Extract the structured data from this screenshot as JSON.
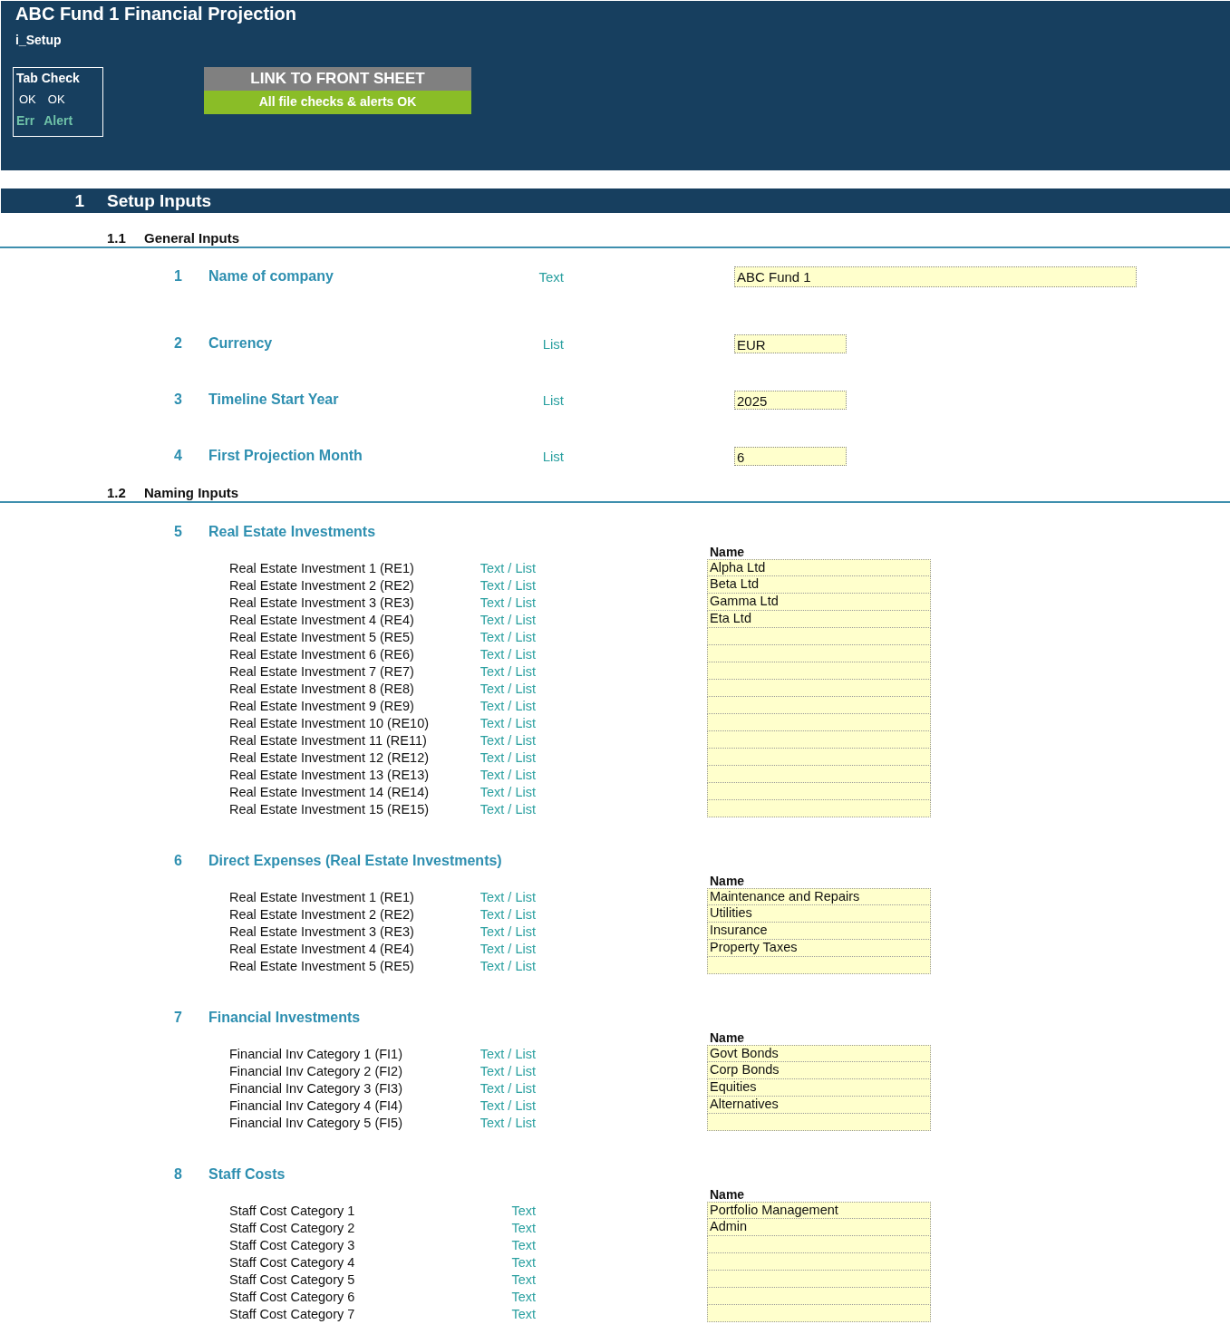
{
  "header": {
    "title": "ABC Fund 1 Financial Projection",
    "sheet": "i_Setup",
    "tab_check": {
      "title": "Tab Check",
      "values": [
        "OK",
        "OK"
      ],
      "labels": [
        "Err",
        "Alert"
      ]
    },
    "link_button": "LINK TO FRONT SHEET",
    "status": "All file checks & alerts OK"
  },
  "section": {
    "number": "1",
    "title": "Setup Inputs"
  },
  "general": {
    "number": "1.1",
    "title": "General Inputs",
    "items": [
      {
        "number": "1",
        "label": "Name of company",
        "type": "Text",
        "value": "ABC Fund 1",
        "kind": "wide"
      },
      {
        "number": "2",
        "label": "Currency",
        "type": "List",
        "value": "EUR",
        "kind": "narrow"
      },
      {
        "number": "3",
        "label": "Timeline Start Year",
        "type": "List",
        "value": "2025",
        "kind": "narrow"
      },
      {
        "number": "4",
        "label": "First Projection Month",
        "type": "List",
        "value": "6",
        "kind": "narrow"
      }
    ]
  },
  "naming": {
    "number": "1.2",
    "title": "Naming Inputs",
    "groups": [
      {
        "number": "5",
        "title": "Real Estate Investments",
        "column_header": "Name",
        "rows": [
          {
            "label": "Real Estate Investment 1 (RE1)",
            "type": "Text / List",
            "value": "Alpha Ltd"
          },
          {
            "label": "Real Estate Investment 2 (RE2)",
            "type": "Text / List",
            "value": "Beta Ltd"
          },
          {
            "label": "Real Estate Investment 3 (RE3)",
            "type": "Text / List",
            "value": "Gamma Ltd"
          },
          {
            "label": "Real Estate Investment 4 (RE4)",
            "type": "Text / List",
            "value": "Eta Ltd"
          },
          {
            "label": "Real Estate Investment 5 (RE5)",
            "type": "Text / List"
          },
          {
            "label": "Real Estate Investment 6 (RE6)",
            "type": "Text / List"
          },
          {
            "label": "Real Estate Investment 7 (RE7)",
            "type": "Text / List"
          },
          {
            "label": "Real Estate Investment 8 (RE8)",
            "type": "Text / List"
          },
          {
            "label": "Real Estate Investment 9 (RE9)",
            "type": "Text / List"
          },
          {
            "label": "Real Estate Investment 10 (RE10)",
            "type": "Text / List"
          },
          {
            "label": "Real Estate Investment 11 (RE11)",
            "type": "Text / List"
          },
          {
            "label": "Real Estate Investment 12 (RE12)",
            "type": "Text / List"
          },
          {
            "label": "Real Estate Investment 13 (RE13)",
            "type": "Text / List"
          },
          {
            "label": "Real Estate Investment 14 (RE14)",
            "type": "Text / List"
          },
          {
            "label": "Real Estate Investment 15 (RE15)",
            "type": "Text / List"
          }
        ]
      },
      {
        "number": "6",
        "title": "Direct Expenses (Real Estate Investments)",
        "column_header": "Name",
        "rows": [
          {
            "label": "Real Estate Investment 1 (RE1)",
            "type": "Text / List",
            "value": "Maintenance and Repairs"
          },
          {
            "label": "Real Estate Investment 2 (RE2)",
            "type": "Text / List",
            "value": "Utilities"
          },
          {
            "label": "Real Estate Investment 3 (RE3)",
            "type": "Text / List",
            "value": "Insurance"
          },
          {
            "label": "Real Estate Investment 4 (RE4)",
            "type": "Text / List",
            "value": "Property Taxes"
          },
          {
            "label": "Real Estate Investment 5 (RE5)",
            "type": "Text / List"
          }
        ]
      },
      {
        "number": "7",
        "title": "Financial Investments",
        "column_header": "Name",
        "rows": [
          {
            "label": "Financial Inv Category 1 (FI1)",
            "type": "Text / List",
            "value": "Govt Bonds"
          },
          {
            "label": "Financial Inv Category 2 (FI2)",
            "type": "Text / List",
            "value": "Corp Bonds"
          },
          {
            "label": "Financial Inv Category 3 (FI3)",
            "type": "Text / List",
            "value": "Equities"
          },
          {
            "label": "Financial Inv Category 4 (FI4)",
            "type": "Text / List",
            "value": "Alternatives"
          },
          {
            "label": "Financial Inv Category 5 (FI5)",
            "type": "Text / List"
          }
        ]
      },
      {
        "number": "8",
        "title": "Staff Costs",
        "column_header": "Name",
        "rows": [
          {
            "label": "Staff Cost Category 1",
            "type": "Text",
            "value": "Portfolio Management"
          },
          {
            "label": "Staff Cost Category 2",
            "type": "Text",
            "value": "Admin"
          },
          {
            "label": "Staff Cost Category 3",
            "type": "Text"
          },
          {
            "label": "Staff Cost Category 4",
            "type": "Text"
          },
          {
            "label": "Staff Cost Category 5",
            "type": "Text"
          },
          {
            "label": "Staff Cost Category 6",
            "type": "Text"
          },
          {
            "label": "Staff Cost Category 7",
            "type": "Text"
          }
        ]
      }
    ]
  }
}
